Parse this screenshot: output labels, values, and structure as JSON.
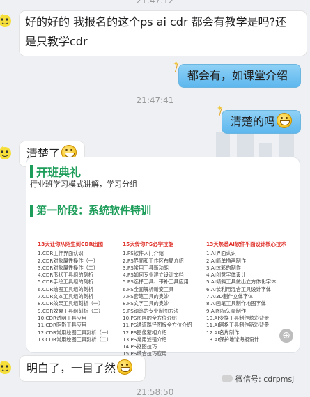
{
  "timestamps": {
    "top": "21:47:12",
    "middle": "21:47:41",
    "bottom": "21:58:50"
  },
  "messages": [
    {
      "side": "left",
      "lines": [
        "好的好的  我报名的这个ps ai cdr 都会有教学是吗?还",
        "是只教学cdr"
      ]
    },
    {
      "side": "right",
      "text": "都会有，如课堂介绍"
    },
    {
      "side": "right",
      "text": "清楚的吗",
      "emoji": "grin-emoji"
    },
    {
      "side": "left",
      "text": "清楚了",
      "emoji": "grin-emoji"
    },
    {
      "side": "left",
      "text": "明白了，一目了然",
      "emoji": "grin-emoji"
    }
  ],
  "card": {
    "title": "开班典礼",
    "subtitle": "行业班学习模式讲解，学习分组",
    "stage_title": "第一阶段：系统软件特训",
    "columns": [
      {
        "head": "13天让你从陌生到CDR出图",
        "items": [
          "1.CDR工作界面认识",
          "2.CDR对象属性操作（一）",
          "3.CDR对象属性操作（二）",
          "4.CDR形状工具组的刻析",
          "5.CDR手绘工具组的刻析",
          "6.CDR绘图工具组的刻析",
          "7.CDR文本工具组的刻析",
          "8.CDR效果工具组刻析（一）",
          "9.CDR效果工具组刻析（二）",
          "10.CDR透明工具应用",
          "11.CDR阴影工具应用",
          "12.CDR常用绘图工具刻析（一）",
          "13.CDR常用绘图工具刻析（二）"
        ]
      },
      {
        "head": "15天传你PS必学技能",
        "items": [
          "1.PS软件入门介绍",
          "2.PS界面和工作区布局介绍",
          "3.PS常用工具新功能",
          "4.PS如何专业建立设计文档",
          "5.PS选择工具、带补工具应用",
          "6.PS全面解析新变工具",
          "7.PS套笔工具的奥妙",
          "8.PS文字工具的奥妙",
          "9.PS钢笔的专业制图方法",
          "10.PS图层的全方位介绍",
          "11.PS通道路径图板全方位介绍",
          "12.PS图像蒙相介绍",
          "13.PS常用滤镜介绍",
          "14.PS抠图技巧",
          "15.PS综合技巧应用"
        ]
      },
      {
        "head": "13天熟悉AI软件平面设计核心技术",
        "items": [
          "1.AI界面认识",
          "2.AI简单插画制作",
          "3.AI炫彩的制作",
          "4.AI创意字体设计",
          "5.AI倾斜工具做出立方体化字体",
          "6.AI长利用混合工具设计字体",
          "7.AI3D制作立体字体",
          "8.AI画笔工具制作地图字体",
          "9.AI图标矢量制作",
          "10.AI变换工具制作炫彩背景",
          "11.AI网格工具制作斯彩背景",
          "12.AI名片制作",
          "13.AI保护地球海报设计"
        ]
      }
    ]
  },
  "watermark": "微信号: cdrpmsj",
  "icons": [
    "user-avatar-icon",
    "magic-wand-icon",
    "zoom-icon",
    "wechat-icon"
  ],
  "colors": {
    "accent_green": "#1d9d5a",
    "column_head_red": "#e0322b",
    "right_bubble_blue": "#5db7ee"
  }
}
